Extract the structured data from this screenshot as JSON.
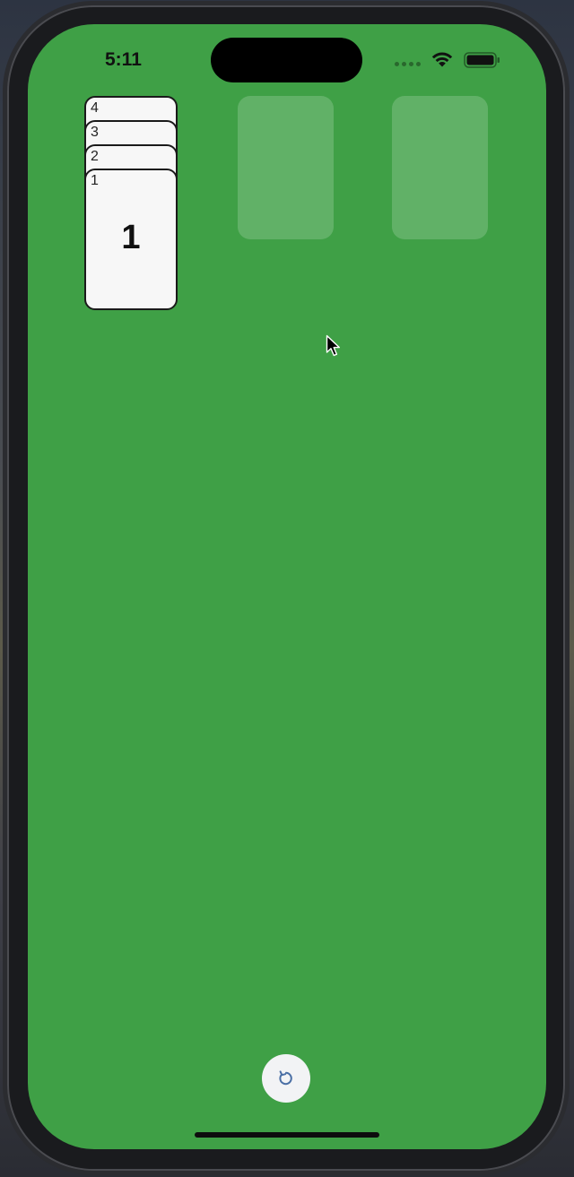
{
  "status_bar": {
    "time": "5:11"
  },
  "pile": {
    "cards": [
      {
        "corner": "4"
      },
      {
        "corner": "3"
      },
      {
        "corner": "2"
      },
      {
        "corner": "1",
        "center": "1"
      }
    ]
  },
  "slots": [
    {
      "name": "empty-slot-1"
    },
    {
      "name": "empty-slot-2"
    }
  ],
  "controls": {
    "reset_icon": "refresh-icon"
  },
  "colors": {
    "table_background": "#3fa046",
    "card_face": "#f7f7f7",
    "card_border": "#1a1a1a",
    "empty_slot": "rgba(255,255,255,0.18)",
    "reset_button": "#f2f3f5",
    "reset_icon": "#4a6fa5"
  }
}
